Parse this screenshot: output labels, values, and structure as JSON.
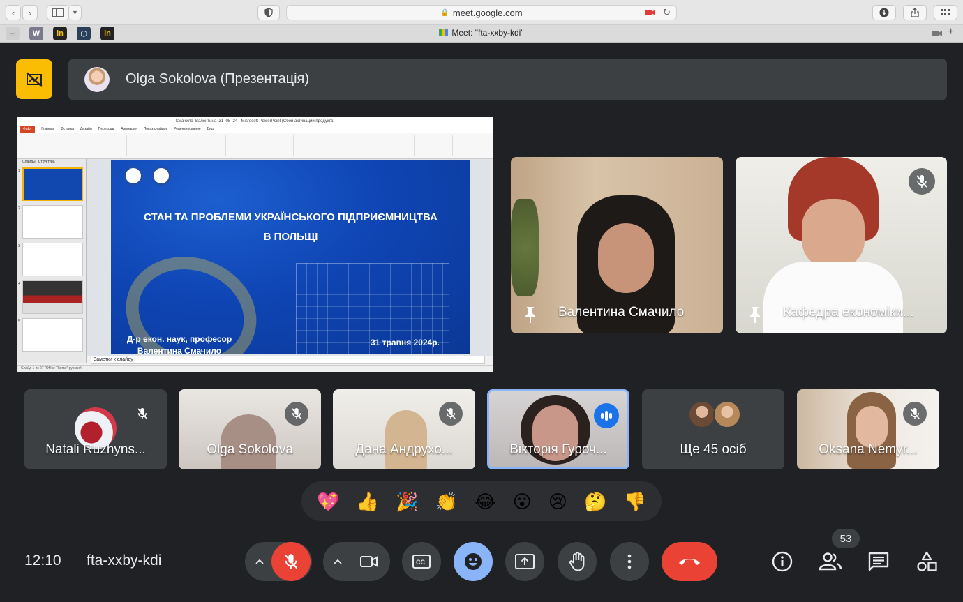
{
  "browser": {
    "url": "meet.google.com",
    "tab_title": "Meet: \"fta-xxby-kdi\"",
    "bookmarks": [
      "W",
      "in",
      "in"
    ]
  },
  "presenter": {
    "name": "Olga Sokolova (Презентація)"
  },
  "slide": {
    "window_title": "Смачило_Валентина_31_05_24 - Microsoft PowerPoint (Сбой активации продукта)",
    "ribbon_tabs": [
      "Файл",
      "Главная",
      "Вставка",
      "Дизайн",
      "Переходы",
      "Анимация",
      "Показ слайдов",
      "Рецензирование",
      "Вид"
    ],
    "panel_tabs": [
      "Слайды",
      "Структура"
    ],
    "title_line1": "СТАН ТА ПРОБЛЕМИ УКРАЇНСЬКОГО ПІДПРИЄМНИЦТВА",
    "title_line2": "В ПОЛЬЩІ",
    "author_line1": "Д-р екон. наук, професор",
    "author_line2": "Валентина Смачило",
    "date": "31 травня 2024р.",
    "notes_placeholder": "Заметки к слайду",
    "status": "Слайд 1 из 27  \"Office Theme\"  русский"
  },
  "pinned_tiles": [
    {
      "name": "Валентина Смачило",
      "muted": false
    },
    {
      "name": "Кафедра економіки...",
      "muted": true
    }
  ],
  "strip_tiles": [
    {
      "name": "Natali Ruzhyns...",
      "muted": true
    },
    {
      "name": "Olga Sokolova",
      "muted": true
    },
    {
      "name": "Дана Андрухо...",
      "muted": true
    },
    {
      "name": "Вікторія Гуроч...",
      "speaking": true
    },
    {
      "name": "Ще 45 осіб"
    },
    {
      "name": "Oksana Nemyr...",
      "muted": true
    }
  ],
  "reactions": [
    "💖",
    "👍",
    "🎉",
    "👏",
    "😂",
    "😮",
    "😢",
    "🤔",
    "👎"
  ],
  "footer": {
    "time": "12:10",
    "meeting_code": "fta-xxby-kdi",
    "participants_count": "53"
  },
  "colors": {
    "background": "#202124",
    "tile": "#3c4043",
    "hangup": "#ea4335",
    "accent": "#8ab4f8",
    "present_badge": "#fbbc04"
  }
}
